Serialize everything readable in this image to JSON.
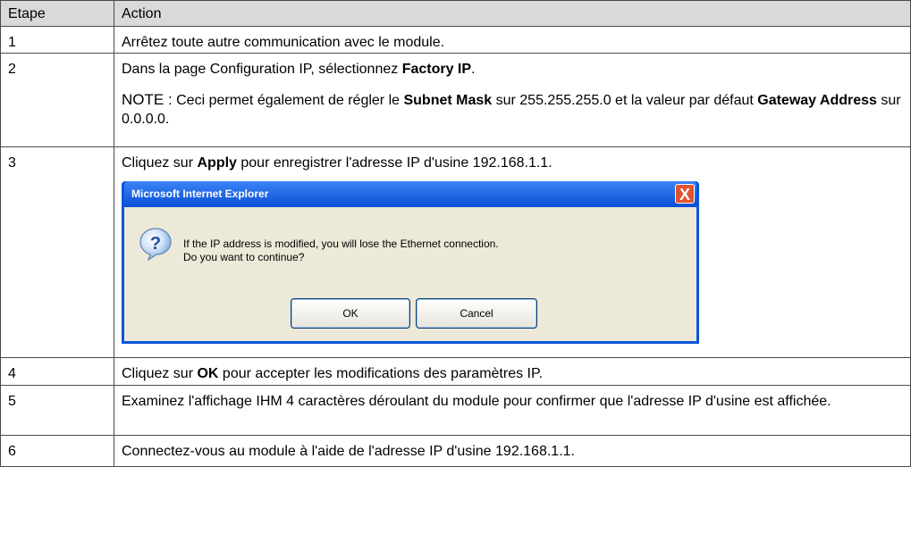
{
  "table": {
    "header": {
      "step": "Etape",
      "action": "Action"
    },
    "rows": [
      {
        "step": "1",
        "text": "Arrêtez toute autre communication avec le module."
      },
      {
        "step": "2",
        "pre": "Dans la page Configuration IP, sélectionnez ",
        "bold": "Factory IP",
        "post": ".",
        "note": {
          "label": "NOTE :",
          "t1": " Ceci permet également de régler le ",
          "b1": "Subnet Mask",
          "t2": " sur 255.255.255.0 et la valeur par défaut ",
          "b2": "Gateway Address",
          "t3": " sur 0.0.0.0."
        }
      },
      {
        "step": "3",
        "pre": "Cliquez sur ",
        "bold": "Apply",
        "post": " pour enregistrer l'adresse IP d'usine 192.168.1.1."
      },
      {
        "step": "4",
        "pre": "Cliquez sur ",
        "bold": "OK",
        "post": " pour accepter les modifications des paramètres IP."
      },
      {
        "step": "5",
        "text": "Examinez l'affichage IHM 4 caractères déroulant du module pour confirmer que l'adresse IP d'usine est affichée."
      },
      {
        "step": "6",
        "text": "Connectez-vous au module à l'aide de l'adresse IP d'usine 192.168.1.1."
      }
    ]
  },
  "dialog": {
    "title": "Microsoft Internet Explorer",
    "close_glyph": "X",
    "message_line1": "If the IP address is modified, you will lose the Ethernet connection.",
    "message_line2": "Do you want to continue?",
    "ok_label": "OK",
    "cancel_label": "Cancel",
    "icon": "question-icon"
  },
  "colors": {
    "header_bg": "#d9d9d9",
    "dialog_frame": "#0a56d8",
    "dialog_body": "#ece9d8",
    "close_button": "#e2522f"
  }
}
